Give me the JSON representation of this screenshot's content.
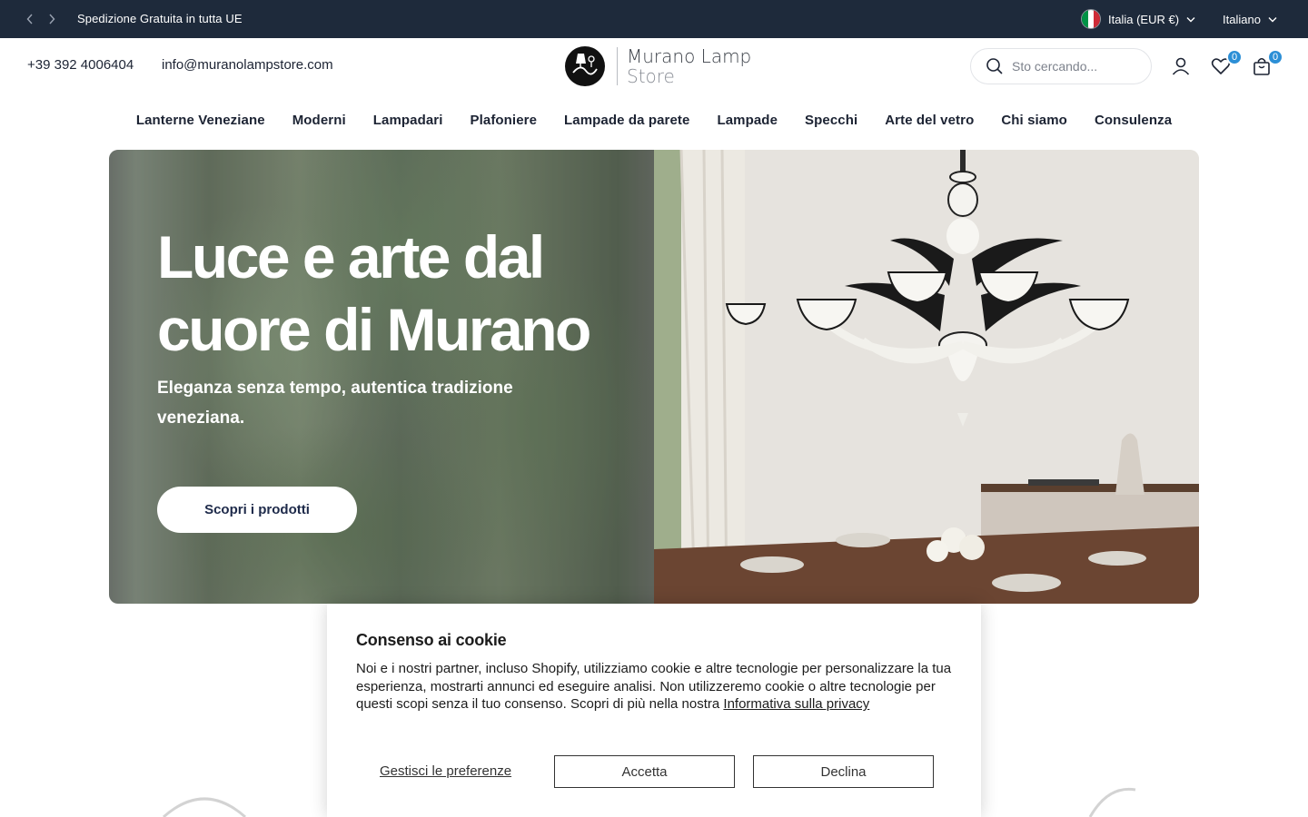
{
  "topbar": {
    "announcement": "Spedizione Gratuita in tutta UE",
    "country": "Italia (EUR €)",
    "language": "Italiano",
    "flag_colors": [
      "#009246",
      "#ffffff",
      "#ce2b37"
    ]
  },
  "header": {
    "phone": "+39 392 4006404",
    "email": "info@muranolampstore.com",
    "logo_line1": "Murano Lamp",
    "logo_line2": "Store",
    "search_placeholder": "Sto cercando...",
    "wishlist_count": "0",
    "cart_count": "0",
    "badge_color": "#2c8fd6"
  },
  "nav": {
    "items": [
      {
        "label": "Lanterne Veneziane"
      },
      {
        "label": "Moderni"
      },
      {
        "label": "Lampadari"
      },
      {
        "label": "Plafoniere"
      },
      {
        "label": "Lampade da parete"
      },
      {
        "label": "Lampade"
      },
      {
        "label": "Specchi"
      },
      {
        "label": "Arte del vetro"
      },
      {
        "label": "Chi siamo"
      },
      {
        "label": "Consulenza"
      }
    ]
  },
  "hero": {
    "title": "Luce e arte dal cuore di Murano",
    "subtitle": "Eleganza senza tempo, autentica tradizione veneziana.",
    "cta": "Scopri i prodotti"
  },
  "cookie": {
    "title": "Consenso ai cookie",
    "text": "Noi e i nostri partner, incluso Shopify, utilizziamo cookie e altre tecnologie per personalizzare la tua esperienza, mostrarti annunci ed eseguire analisi. Non utilizzeremo cookie o altre tecnologie per questi scopi senza il tuo consenso. Scopri di più nella nostra ",
    "privacy_link": "Informativa sulla privacy",
    "manage": "Gestisci le preferenze",
    "accept": "Accetta",
    "decline": "Declina"
  },
  "colors": {
    "topbar_bg": "#1e2a3b",
    "text": "#1c2333"
  }
}
